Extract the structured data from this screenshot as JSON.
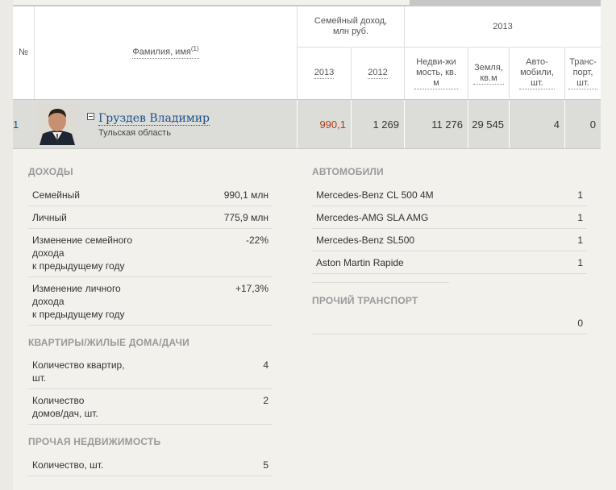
{
  "table_header": {
    "number": "№",
    "name": "Фамилия, имя",
    "name_footnote": "(1)",
    "family_income": "Семейный доход, млн руб.",
    "year_group": "2013",
    "col_2013": "2013",
    "col_2012": "2012",
    "real_estate": "Недви-жимость, кв.м",
    "land": "Земля, кв.м",
    "cars": "Авто-мобили, шт.",
    "transport": "Транс-порт, шт."
  },
  "person": {
    "number": "1",
    "name": "Груздев Владимир",
    "region": "Тульская область",
    "income_2013": "990,1",
    "income_2012": "1 269",
    "real_estate": "11 276",
    "land": "29 545",
    "cars": "4",
    "transport": "0",
    "highlight_color": "#b03a12"
  },
  "details": {
    "income": {
      "title": "ДОХОДЫ",
      "rows": [
        {
          "label": "Семейный",
          "value": "990,1 млн"
        },
        {
          "label": "Личный",
          "value": "775,9 млн"
        },
        {
          "label": "Изменение семейного\nдохода\nк предыдущему году",
          "value": "-22%"
        },
        {
          "label": "Изменение личного\nдохода\nк предыдущему году",
          "value": "+17,3%"
        }
      ]
    },
    "housing": {
      "title": "КВАРТИРЫ/ЖИЛЫЕ ДОМА/ДАЧИ",
      "rows": [
        {
          "label": "Количество квартир,\nшт.",
          "value": "4"
        },
        {
          "label": "Количество\nдомов/дач, шт.",
          "value": "2"
        }
      ]
    },
    "other_property": {
      "title": "ПРОЧАЯ НЕДВИЖИМОСТЬ",
      "rows": [
        {
          "label": "Количество, шт.",
          "value": "5"
        }
      ]
    },
    "cars": {
      "title": "АВТОМОБИЛИ",
      "rows": [
        {
          "label": "Mercedes-Benz CL 500 4M",
          "value": "1"
        },
        {
          "label": "Mercedes-AMG SLA AMG",
          "value": "1"
        },
        {
          "label": "Mercedes-Benz SL500",
          "value": "1"
        },
        {
          "label": "Aston Martin Rapide",
          "value": "1"
        }
      ]
    },
    "other_transport": {
      "title": "ПРОЧИЙ ТРАНСПОРТ",
      "rows": [
        {
          "label": "",
          "value": "0"
        }
      ]
    }
  }
}
